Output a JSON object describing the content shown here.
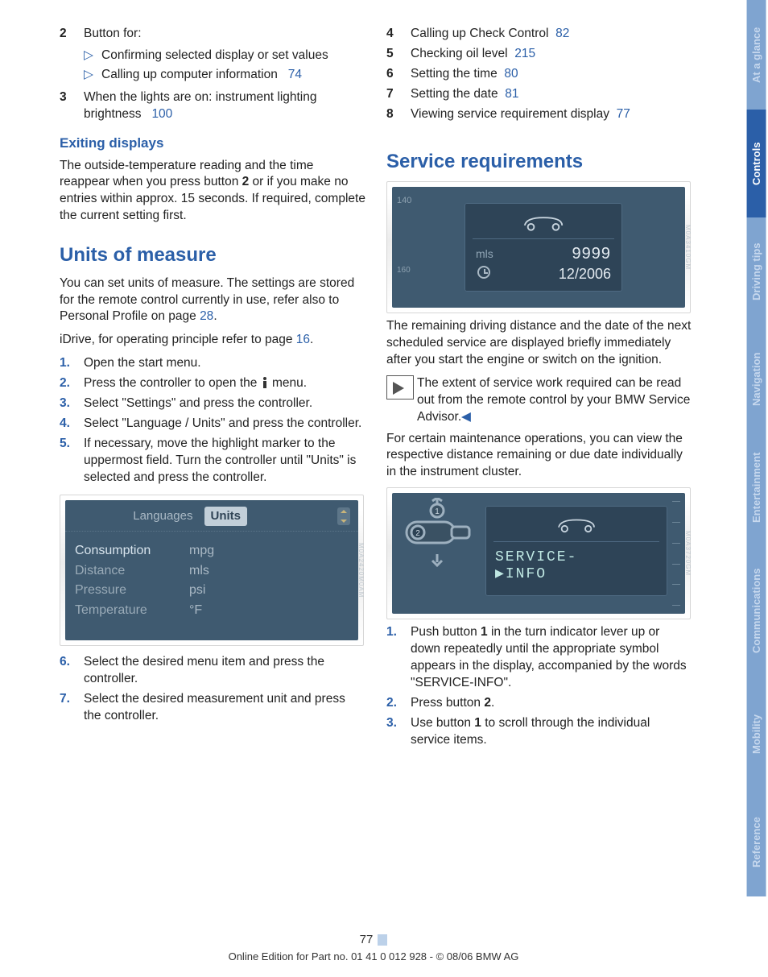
{
  "tabs": {
    "ataglance": "At a glance",
    "controls": "Controls",
    "driving": "Driving tips",
    "navigation": "Navigation",
    "entertain": "Entertainment",
    "comm": "Communications",
    "mobility": "Mobility",
    "reference": "Reference"
  },
  "left": {
    "item2": {
      "num": "2",
      "label": "Button for:"
    },
    "item2_bullets": [
      "Confirming selected display or set values",
      "Calling up computer information"
    ],
    "item2_bullet2_ref": "74",
    "item3": {
      "num": "3",
      "text": "When the lights are on: instrument lighting brightness",
      "ref": "100"
    },
    "exiting_h": "Exiting displays",
    "exiting_p_a": "The outside-temperature reading and the time reappear when you press button ",
    "exiting_p_b": "2",
    "exiting_p_c": " or if you make no entries within approx. 15 seconds. If required, complete the current setting first.",
    "units_h": "Units of measure",
    "units_p1_a": "You can set units of measure. The settings are stored for the remote control currently in use, refer also to Personal Profile on page ",
    "units_p1_ref": "28",
    "units_p1_b": ".",
    "units_p2_a": "iDrive, for operating principle refer to page ",
    "units_p2_ref": "16",
    "units_p2_b": ".",
    "steps": [
      "Open the start menu.",
      "Press the controller to open the __ICON__ menu.",
      "Select \"Settings\" and press the controller.",
      "Select \"Language / Units\" and press the controller.",
      "If necessary, move the highlight marker to the uppermost field. Turn the controller until \"Units\" is selected and press the controller."
    ],
    "idrive_screenshot": {
      "tab_other": "Languages",
      "tab_selected": "Units",
      "rows": [
        {
          "k": "Consumption",
          "v": "mpg",
          "hl": true
        },
        {
          "k": "Distance",
          "v": "mls",
          "hl": false
        },
        {
          "k": "Pressure",
          "v": "psi",
          "hl": false
        },
        {
          "k": "Temperature",
          "v": "°F",
          "hl": false
        }
      ]
    },
    "step6": {
      "num": "6.",
      "text": "Select the desired menu item and press the controller."
    },
    "step7": {
      "num": "7.",
      "text": "Select the desired measurement unit and press the controller."
    }
  },
  "right": {
    "items": [
      {
        "num": "4",
        "text": "Calling up Check Control",
        "ref": "82"
      },
      {
        "num": "5",
        "text": "Checking oil level",
        "ref": "215"
      },
      {
        "num": "6",
        "text": "Setting the time",
        "ref": "80"
      },
      {
        "num": "7",
        "text": "Setting the date",
        "ref": "81"
      },
      {
        "num": "8",
        "text": "Viewing service requirement display",
        "ref": "77"
      }
    ],
    "svc_h": "Service requirements",
    "svc1": {
      "mls": "mls",
      "miles": "9999",
      "date": "12/2006",
      "g140": "140",
      "g160": "160"
    },
    "svc_p1": "The remaining driving distance and the date of the next scheduled service are displayed briefly immediately after you start the engine or switch on the ignition.",
    "svc_note": "The extent of service work required can be read out from the remote control by your BMW Service Advisor.",
    "svc_p2": "For certain maintenance operations, you can view the respective distance remaining or due date individually in the instrument cluster.",
    "svc2": {
      "line1": "SERVICE-",
      "line2": "INFO"
    },
    "steps2": [
      {
        "num": "1.",
        "pre": "Push button ",
        "b": "1",
        "post": " in the turn indicator lever up or down repeatedly until the appropriate symbol appears in the display, accompanied by the words \"SERVICE-INFO\"."
      },
      {
        "num": "2.",
        "pre": "Press button ",
        "b": "2",
        "post": "."
      },
      {
        "num": "3.",
        "pre": "Use button ",
        "b": "1",
        "post": " to scroll through the individual service items."
      }
    ]
  },
  "footer": {
    "page": "77",
    "line": "Online Edition for Part no. 01 41 0 012 928 - © 08/06 BMW AG"
  }
}
